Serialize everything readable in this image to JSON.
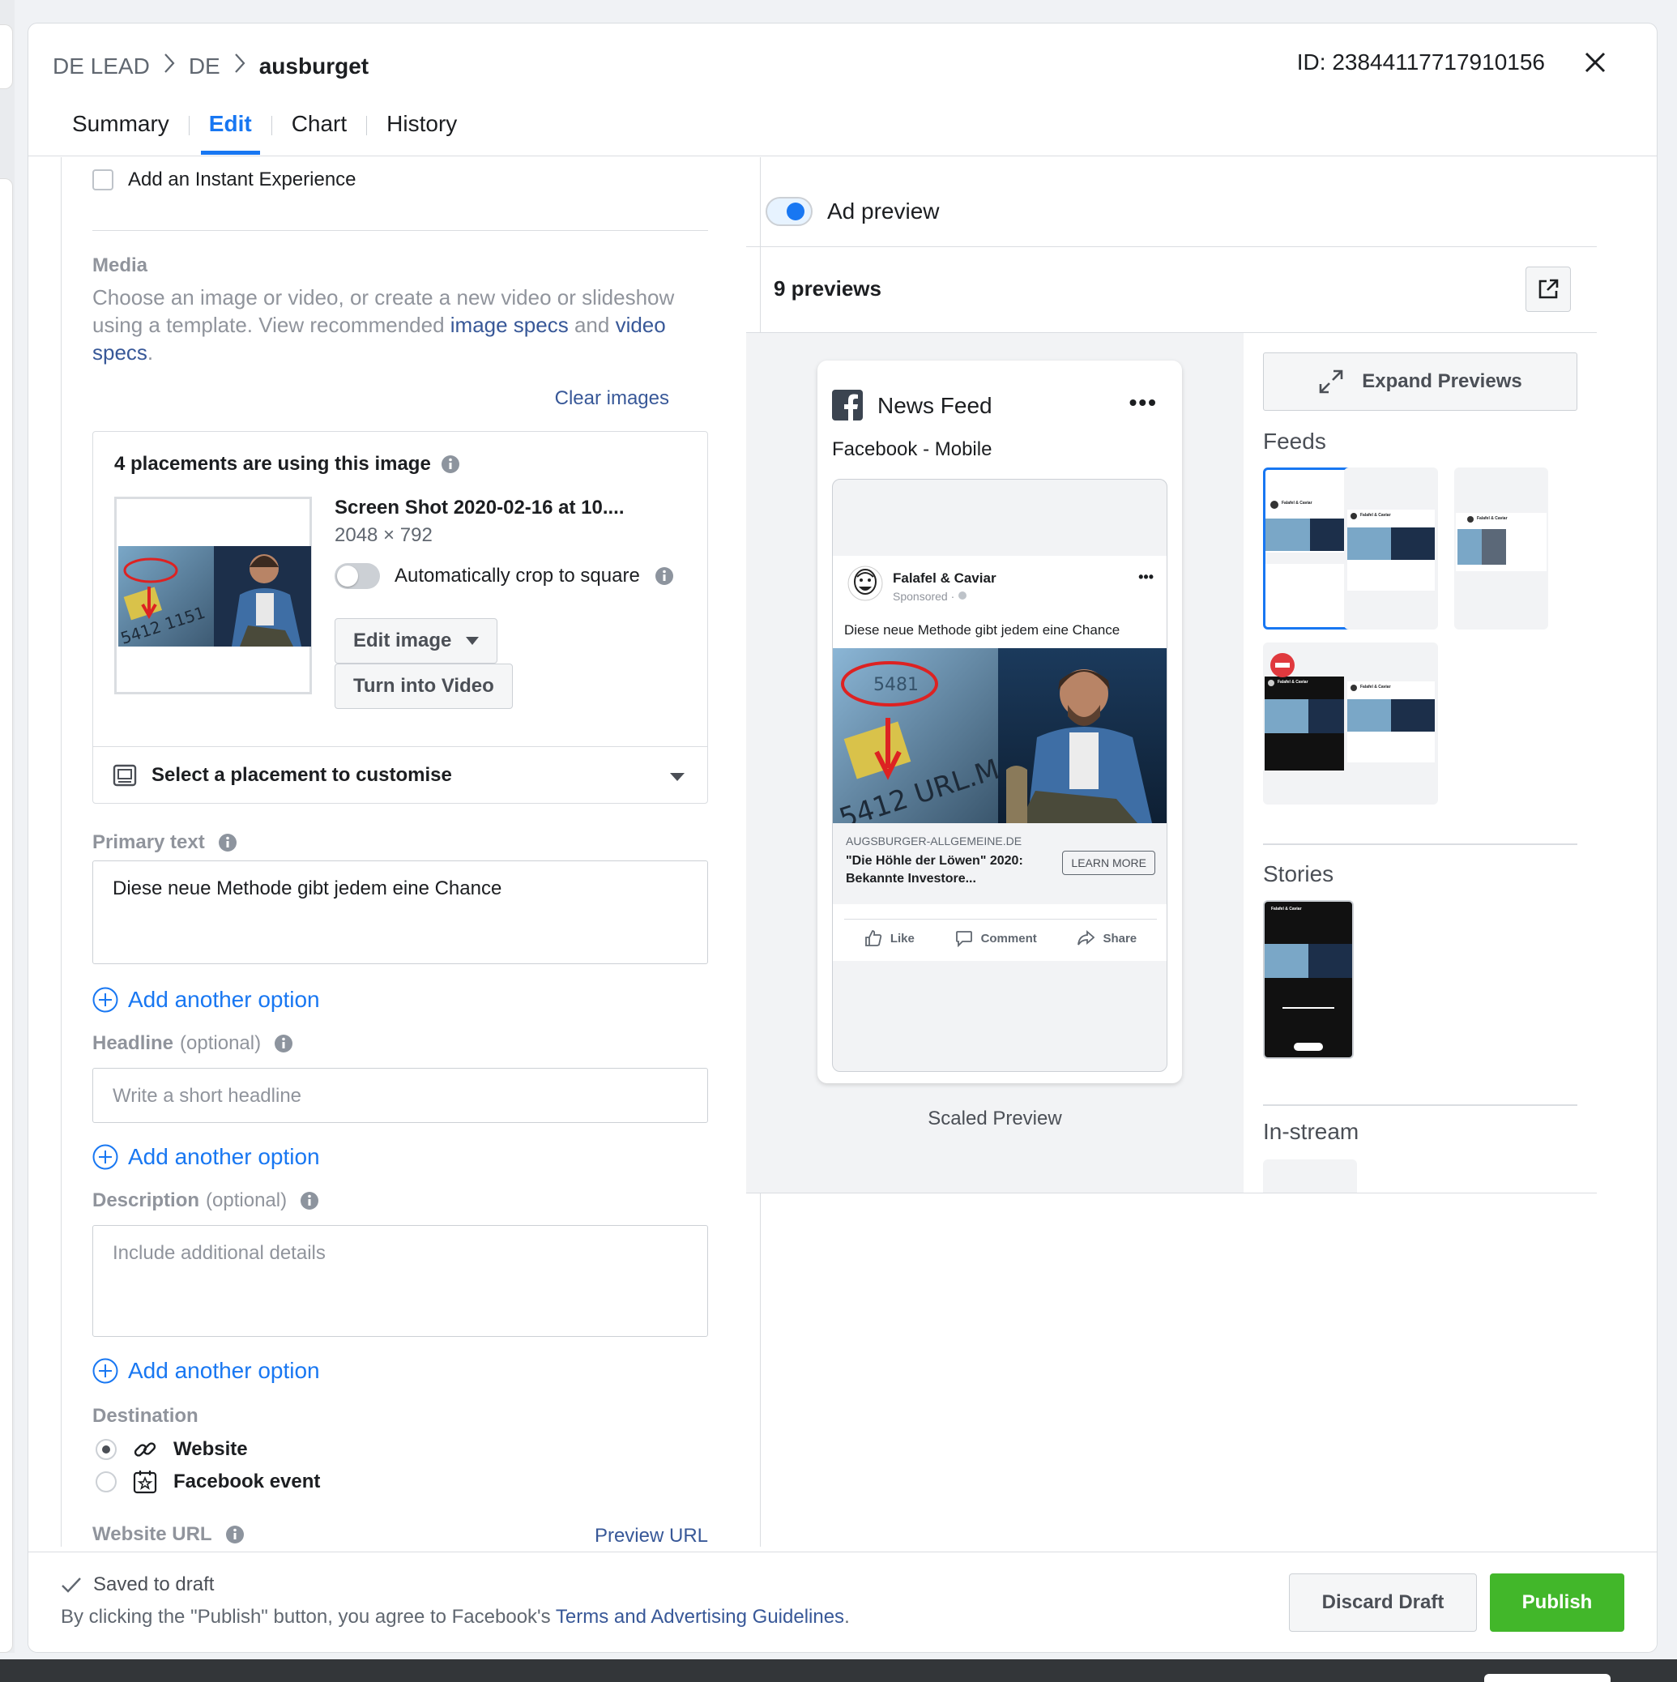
{
  "breadcrumb": [
    "DE LEAD",
    "DE",
    "ausburget"
  ],
  "ad_id": "ID: 23844117717910156",
  "tabs": [
    {
      "label": "Summary",
      "active": false
    },
    {
      "label": "Edit",
      "active": true
    },
    {
      "label": "Chart",
      "active": false
    },
    {
      "label": "History",
      "active": false
    }
  ],
  "form": {
    "instant_experience_label": "Add an Instant Experience",
    "media": {
      "label": "Media",
      "desc_prefix": "Choose an image or video, or create a new video or slideshow using a template. View recommended ",
      "image_specs": "image specs",
      "and": " and ",
      "video_specs": "video specs",
      "period": ".",
      "clear_images": "Clear images"
    },
    "placements": {
      "title": "4 placements are using this image",
      "file_name": "Screen Shot 2020-02-16 at 10....",
      "file_dims": "2048 × 792",
      "crop_label": "Automatically crop to square",
      "edit_image": "Edit image",
      "turn_into_video": "Turn into Video",
      "select_placement": "Select a placement to customise"
    },
    "primary_text": {
      "label": "Primary text",
      "value": "Diese neue Methode gibt jedem eine Chance"
    },
    "add_option": "Add another option",
    "headline": {
      "label": "Headline",
      "optional": "(optional)",
      "placeholder": "Write a short headline"
    },
    "description": {
      "label": "Description",
      "optional": "(optional)",
      "placeholder": "Include additional details"
    },
    "destination": {
      "label": "Destination",
      "options": [
        "Website",
        "Facebook event"
      ],
      "selected": "Website"
    },
    "website_url": {
      "label": "Website URL",
      "preview_link": "Preview URL"
    }
  },
  "preview": {
    "toggle_label": "Ad preview",
    "count": "9 previews",
    "phone": {
      "title": "News Feed",
      "platform": "Facebook - Mobile",
      "page_name": "Falafel & Caviar",
      "sponsored": "Sponsored · ",
      "ad_text": "Diese neue Methode gibt jedem eine Chance",
      "domain": "AUGSBURGER-ALLGEMEINE.DE",
      "headline": "\"Die Höhle der Löwen\" 2020: Bekannte Investore...",
      "cta": "LEARN MORE",
      "actions": [
        "Like",
        "Comment",
        "Share"
      ]
    },
    "scaled_label": "Scaled Preview",
    "expand": "Expand Previews",
    "sections": [
      "Feeds",
      "Stories",
      "In-stream"
    ],
    "mini_page_name": "Falafel & Caviar"
  },
  "footer": {
    "saved": "Saved to draft",
    "terms_prefix": "By clicking the \"Publish\" button, you agree to Facebook's ",
    "terms_link": "Terms and Advertising Guidelines",
    "terms_suffix": ".",
    "discard": "Discard Draft",
    "publish": "Publish"
  },
  "colors": {
    "accent": "#1877f2",
    "link": "#385898",
    "publish": "#42b72a"
  },
  "icons": [
    "chevron-right-icon",
    "close-icon",
    "info-icon",
    "placement-icon",
    "caret-down-icon",
    "plus-circle-icon",
    "link-icon",
    "event-icon",
    "open-new-window-icon",
    "expand-icon",
    "facebook-logo-icon",
    "like-icon",
    "comment-icon",
    "share-icon",
    "globe-icon",
    "check-icon",
    "no-entry-icon"
  ]
}
